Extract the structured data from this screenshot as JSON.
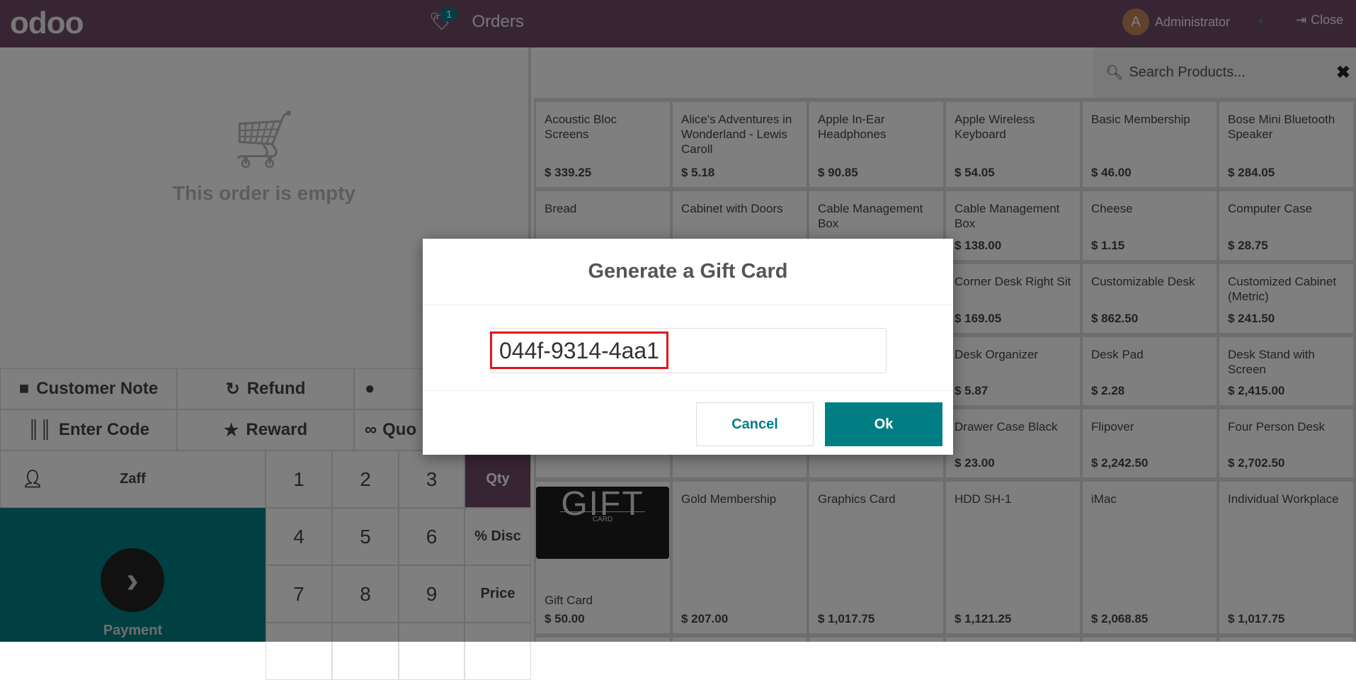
{
  "header": {
    "logo": "odoo",
    "orders_label": "Orders",
    "orders_badge": "1",
    "user_initial": "A",
    "user_name": "Administrator",
    "close_label": "Close"
  },
  "order": {
    "empty_text": "This order is empty"
  },
  "controls": [
    "Customer Note",
    "Refund",
    "",
    "Enter Code",
    "Reward",
    "Quo"
  ],
  "customer": "Zaff",
  "numpad": [
    "1",
    "2",
    "3",
    "Qty",
    "4",
    "5",
    "6",
    "% Disc",
    "7",
    "8",
    "9",
    "Price"
  ],
  "payment_label": "Payment",
  "search": {
    "placeholder": "Search Products..."
  },
  "products": [
    {
      "name": "Acoustic Bloc Screens",
      "price": "$ 339.25"
    },
    {
      "name": "Alice's Adventures in Wonderland - Lewis Caroll",
      "price": "$ 5.18"
    },
    {
      "name": "Apple In-Ear Headphones",
      "price": "$ 90.85"
    },
    {
      "name": "Apple Wireless Keyboard",
      "price": "$ 54.05"
    },
    {
      "name": "Basic Membership",
      "price": "$ 46.00"
    },
    {
      "name": "Bose Mini Bluetooth Speaker",
      "price": "$ 284.05"
    },
    {
      "name": "Bread",
      "price": ""
    },
    {
      "name": "Cabinet with Doors",
      "price": ""
    },
    {
      "name": "Cable Management Box",
      "price": ""
    },
    {
      "name": "Cable Management Box",
      "price": "$ 138.00"
    },
    {
      "name": "Cheese",
      "price": "$ 1.15"
    },
    {
      "name": "Computer Case",
      "price": "$ 28.75"
    },
    {
      "name": "",
      "price": ""
    },
    {
      "name": "",
      "price": ""
    },
    {
      "name": "",
      "price": ""
    },
    {
      "name": "Corner Desk Right Sit",
      "price": "$ 169.05"
    },
    {
      "name": "Customizable Desk",
      "price": "$ 862.50"
    },
    {
      "name": "Customized Cabinet (Metric)",
      "price": "$ 241.50"
    },
    {
      "name": "",
      "price": ""
    },
    {
      "name": "",
      "price": ""
    },
    {
      "name": "",
      "price": ""
    },
    {
      "name": "Desk Organizer",
      "price": "$ 5.87"
    },
    {
      "name": "Desk Pad",
      "price": "$ 2.28"
    },
    {
      "name": "Desk Stand with Screen",
      "price": "$ 2,415.00"
    },
    {
      "name": "",
      "price": ""
    },
    {
      "name": "",
      "price": ""
    },
    {
      "name": "",
      "price": ""
    },
    {
      "name": "Drawer Case Black",
      "price": "$ 23.00"
    },
    {
      "name": "Flipover",
      "price": "$ 2,242.50"
    },
    {
      "name": "Four Person Desk",
      "price": "$ 2,702.50"
    },
    {
      "name": "Gift Card",
      "price": "$ 50.00",
      "image": "gift-card"
    },
    {
      "name": "Gold Membership",
      "price": "$ 207.00"
    },
    {
      "name": "Graphics Card",
      "price": "$ 1,017.75"
    },
    {
      "name": "HDD SH-1",
      "price": "$ 1,121.25"
    },
    {
      "name": "iMac",
      "price": "$ 2,068.85"
    },
    {
      "name": "Individual Workplace",
      "price": "$ 1,017.75"
    }
  ],
  "gift_image": {
    "big": "GIFT",
    "small": "CARD"
  },
  "modal": {
    "title": "Generate a Gift Card",
    "code": "044f-9314-4aa1",
    "cancel": "Cancel",
    "ok": "Ok"
  },
  "colors": {
    "brand": "#714B67",
    "accent": "#017E84",
    "highlight": "#e3141b"
  }
}
